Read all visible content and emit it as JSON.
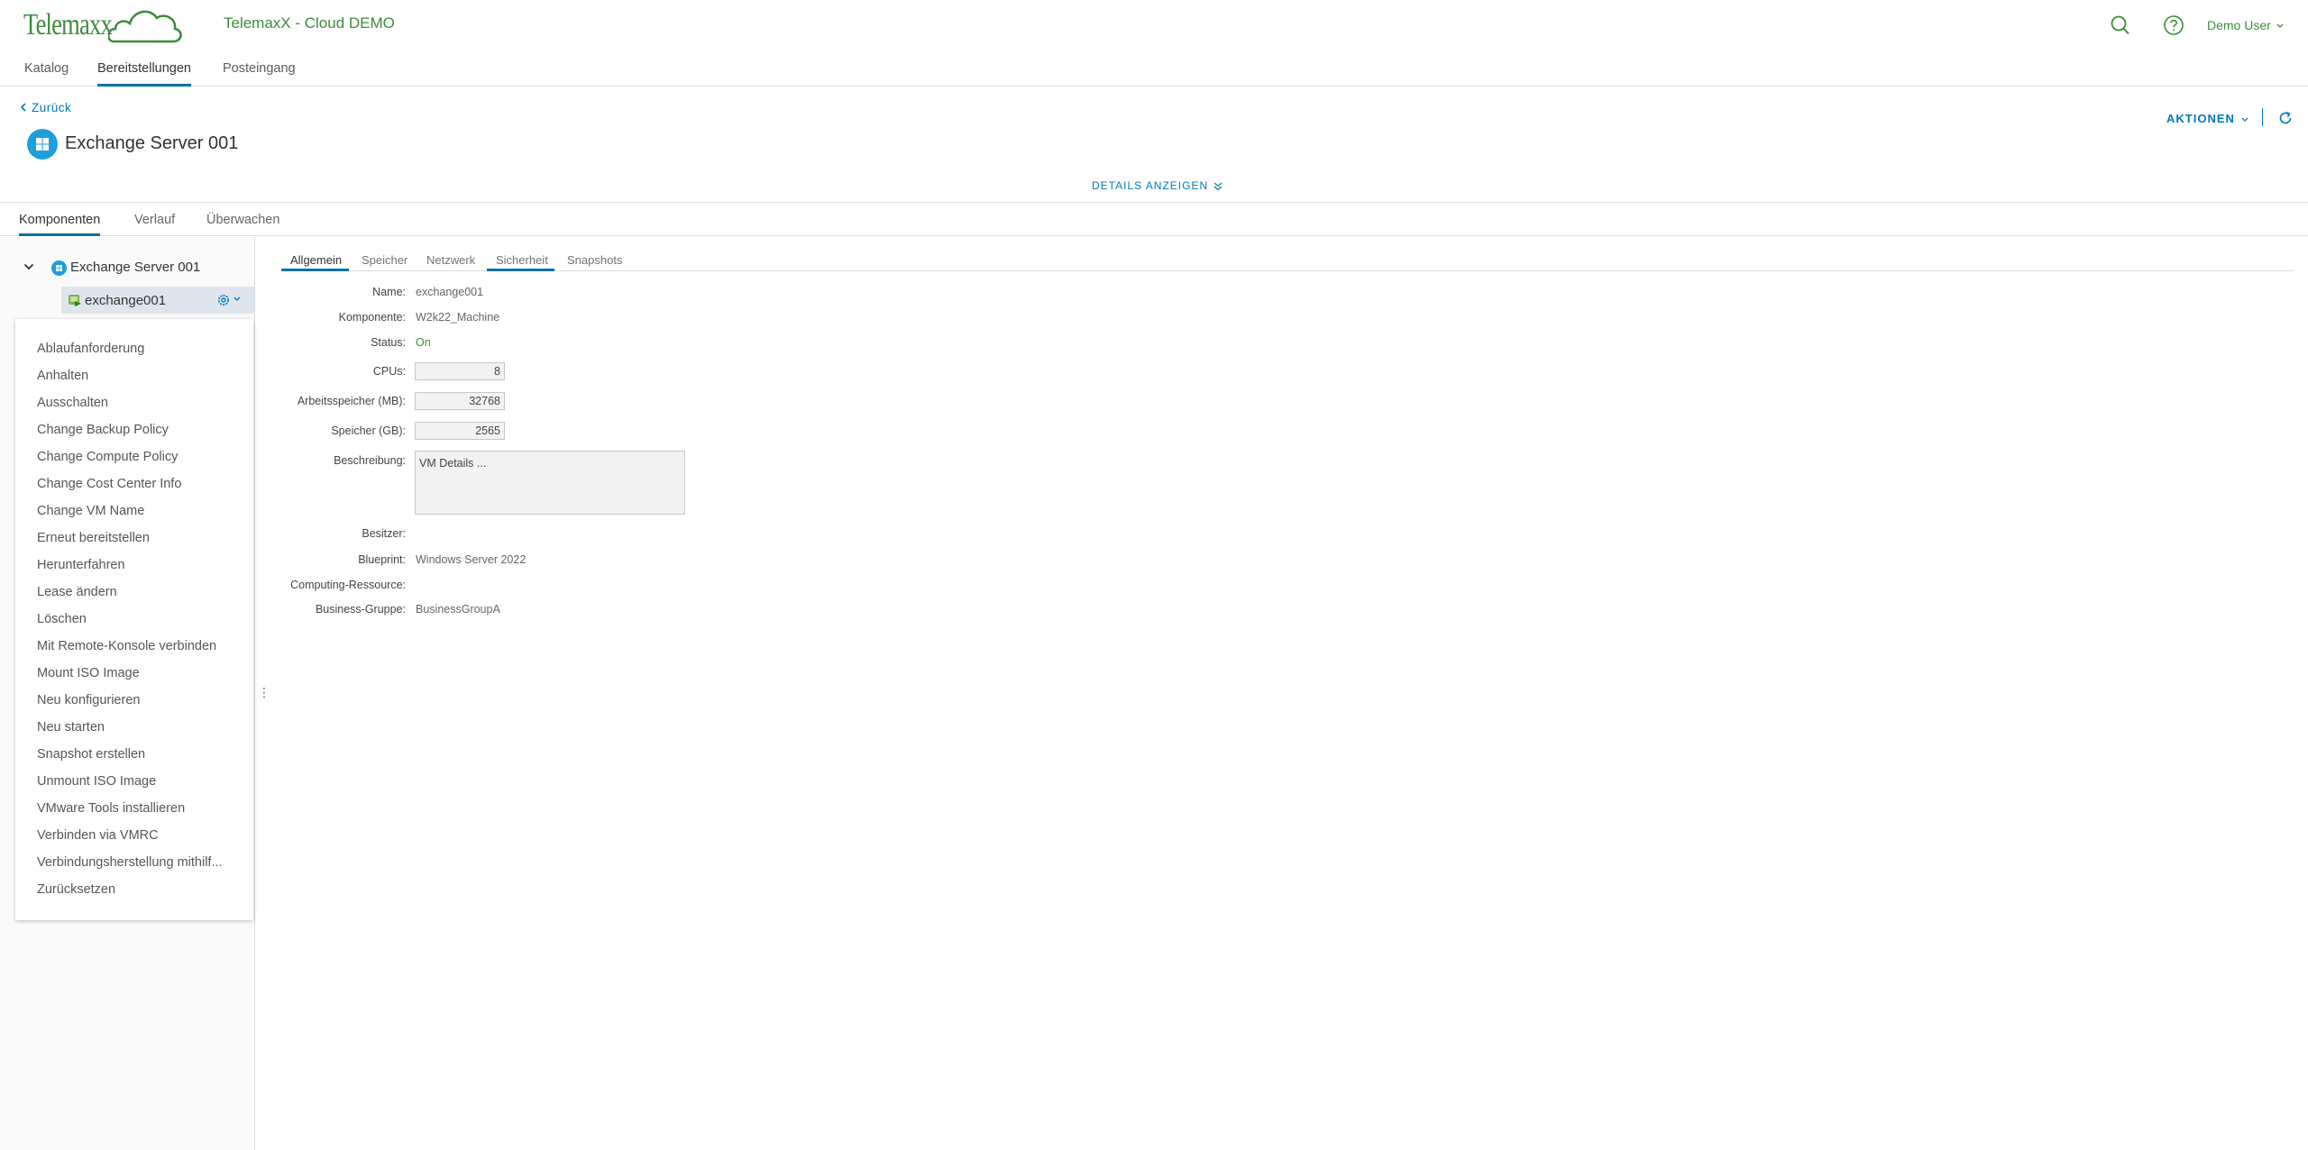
{
  "header": {
    "logo_text": "Telemaxx",
    "app_title": "TelemaxX - Cloud DEMO",
    "user": "Demo User",
    "brand_color": "#3d8b3d"
  },
  "main_nav": {
    "tabs": [
      {
        "label": "Katalog"
      },
      {
        "label": "Bereitstellungen",
        "active": true
      },
      {
        "label": "Posteingang"
      }
    ]
  },
  "deployment": {
    "back_label": "Zurück",
    "title": "Exchange Server 001",
    "actions_label": "AKTIONEN",
    "details_label": "DETAILS ANZEIGEN"
  },
  "component_tabs": [
    {
      "label": "Komponenten",
      "active": true
    },
    {
      "label": "Verlauf"
    },
    {
      "label": "Überwachen"
    }
  ],
  "tree": {
    "root": "Exchange Server 001",
    "child": "exchange001"
  },
  "context_menu": [
    "Ablaufanforderung",
    "Anhalten",
    "Ausschalten",
    "Change Backup Policy",
    "Change Compute Policy",
    "Change Cost Center Info",
    "Change VM Name",
    "Erneut bereitstellen",
    "Herunterfahren",
    "Lease ändern",
    "Löschen",
    "Mit Remote-Konsole verbinden",
    "Mount ISO Image",
    "Neu konfigurieren",
    "Neu starten",
    "Snapshot erstellen",
    "Unmount ISO Image",
    "VMware Tools installieren",
    "Verbinden via VMRC",
    "Verbindungsherstellung mithilf...",
    "Zurücksetzen"
  ],
  "detail_tabs": [
    {
      "label": "Allgemein",
      "active": true
    },
    {
      "label": "Speicher"
    },
    {
      "label": "Netzwerk"
    },
    {
      "label": "Sicherheit"
    },
    {
      "label": "Snapshots"
    }
  ],
  "form": {
    "name": {
      "label": "Name:",
      "value": "exchange001"
    },
    "komponente": {
      "label": "Komponente:",
      "value": "W2k22_Machine"
    },
    "status": {
      "label": "Status:",
      "value": "On"
    },
    "cpus": {
      "label": "CPUs:",
      "value": "8"
    },
    "memory": {
      "label": "Arbeitsspeicher (MB):",
      "value": "32768"
    },
    "storage": {
      "label": "Speicher (GB):",
      "value": "2565"
    },
    "description": {
      "label": "Beschreibung:",
      "value": "VM Details ..."
    },
    "owner": {
      "label": "Besitzer:",
      "value": ""
    },
    "blueprint": {
      "label": "Blueprint:",
      "value": "Windows Server 2022"
    },
    "computing": {
      "label": "Computing-Ressource:",
      "value": ""
    },
    "business_group": {
      "label": "Business-Gruppe:",
      "value": "BusinessGroupA"
    }
  }
}
